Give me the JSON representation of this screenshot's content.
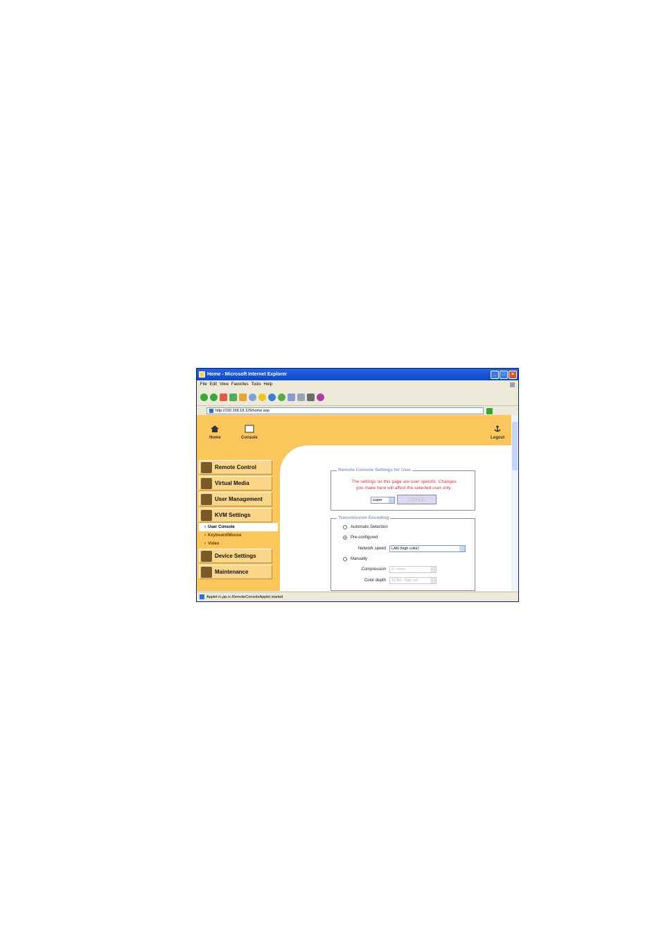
{
  "window": {
    "title": "Home - Microsoft Internet Explorer"
  },
  "menu": [
    "File",
    "Edit",
    "View",
    "Favorites",
    "Tools",
    "Help"
  ],
  "address": {
    "url": "http://192.168.18.129/home.asp"
  },
  "topnav": {
    "home": "Home",
    "console": "Console",
    "logout": "Logout"
  },
  "sidebar": {
    "items": [
      "Remote Control",
      "Virtual Media",
      "User Management",
      "KVM Settings"
    ],
    "subitems": [
      "User Console",
      "Keyboard/Mouse",
      "Video"
    ],
    "items2": [
      "Device Settings",
      "Maintenance"
    ]
  },
  "remote_console": {
    "legend": "Remote Console Settings for User",
    "notice_line1": "The settings on this page are user specific. Changes",
    "notice_line2": "you make here will affect the selected user only.",
    "user_value": "super",
    "update_button": "Update"
  },
  "transmission": {
    "legend": "Transmission Encoding",
    "auto": "Automatic Detection",
    "preconfigured": "Pre-configured",
    "network_speed_label": "Network speed",
    "network_speed_value": "LAN (high color)",
    "manually": "Manually",
    "compression_label": "Compression",
    "compression_value": "0 - none",
    "color_depth_label": "Color depth",
    "color_depth_value": "16 Bit - high col"
  },
  "statusbar": {
    "text": "Applet rc.pp.rc.RemoteConsoleApplet started"
  },
  "colors": {
    "accent": "#fbc75c",
    "title_blue": "#0b47c9",
    "notice": "#d0333e"
  }
}
